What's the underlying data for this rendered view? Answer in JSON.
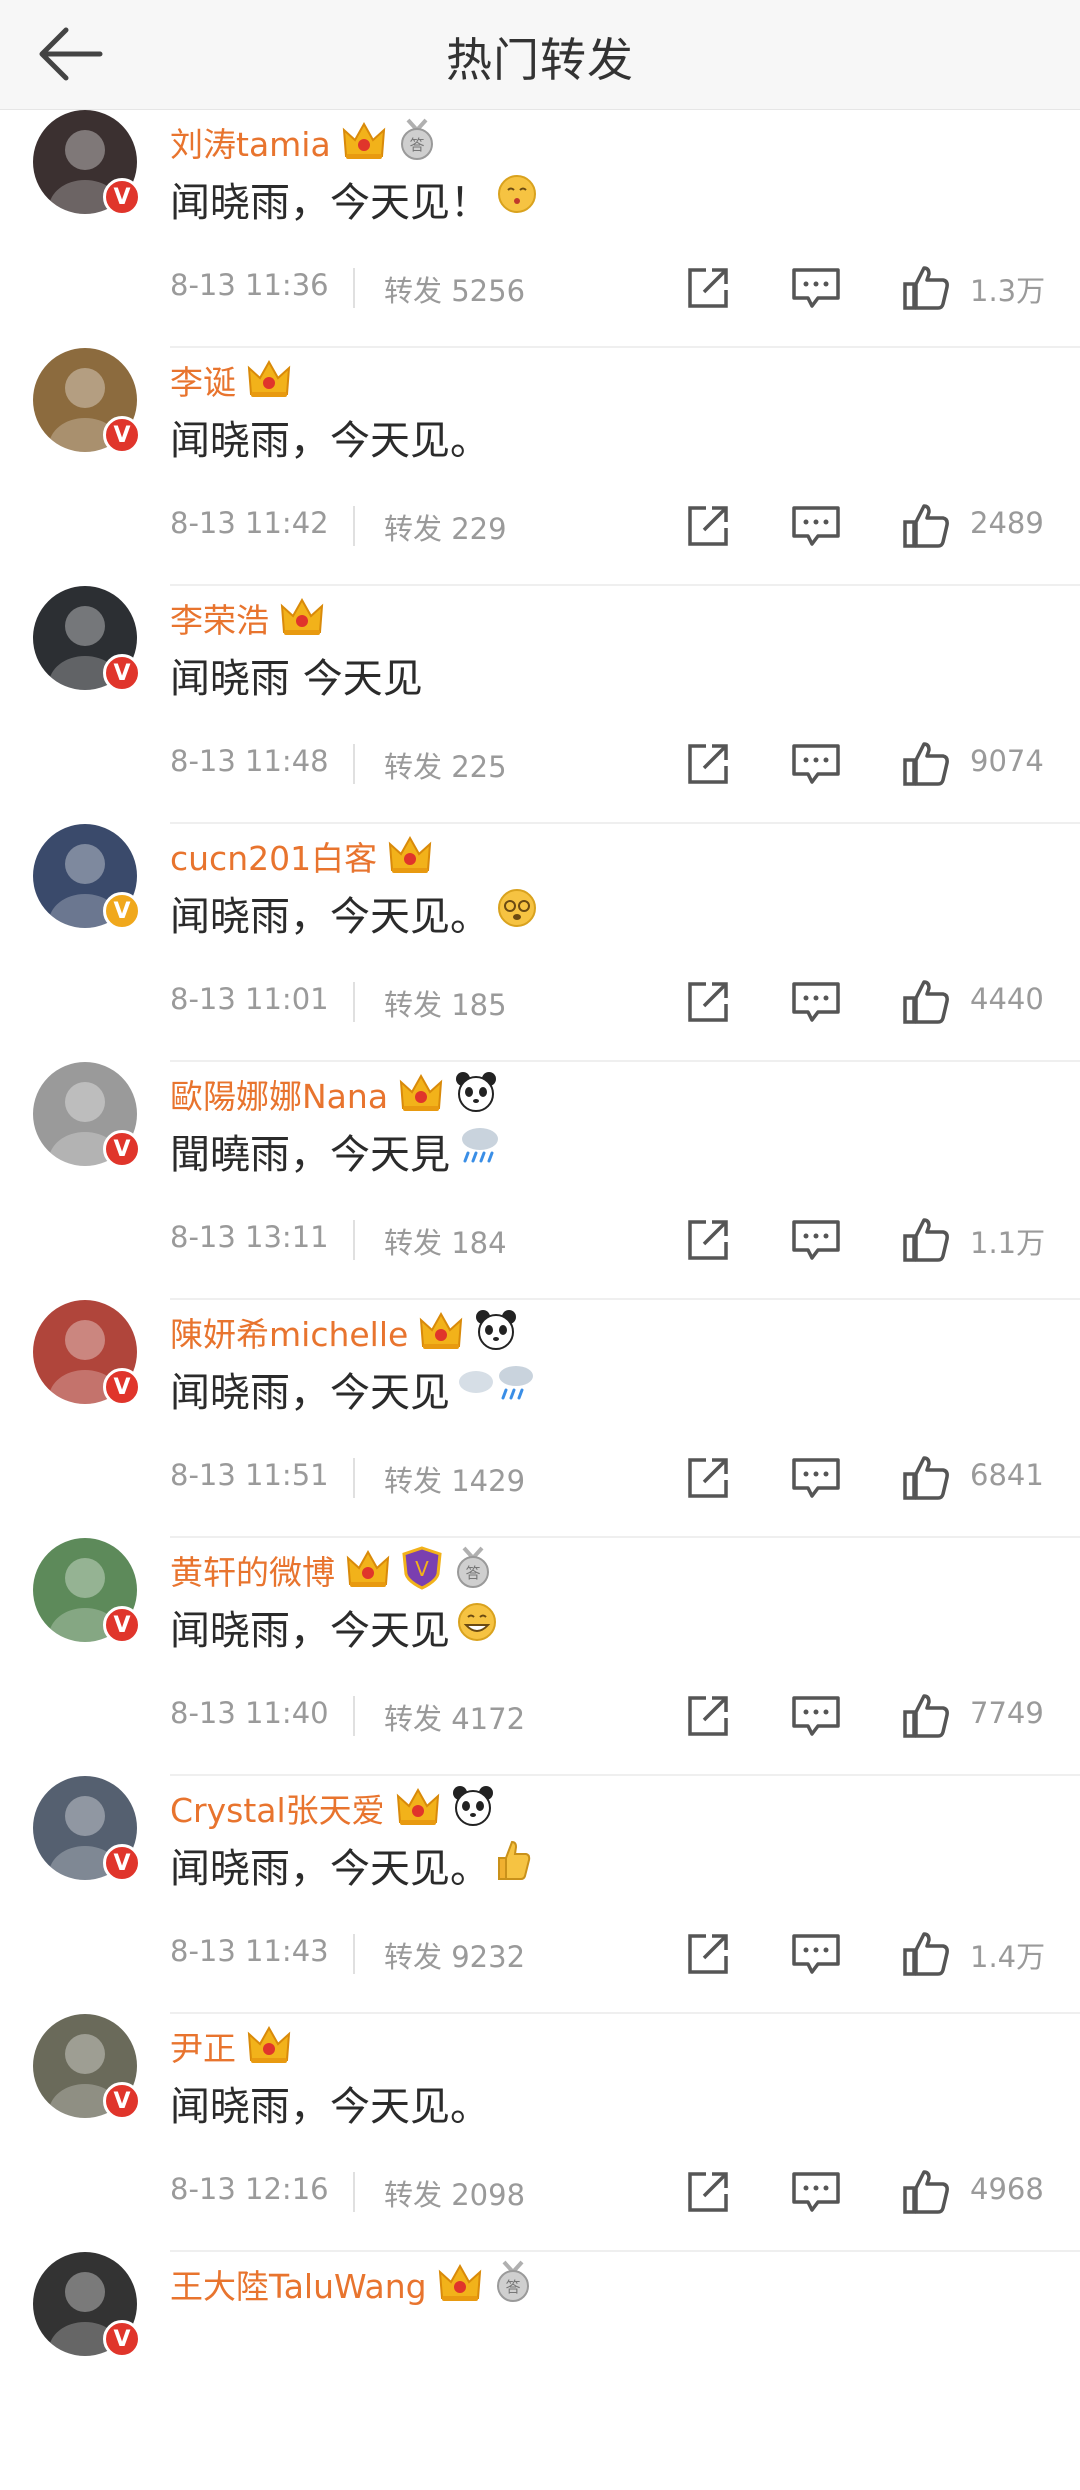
{
  "header": {
    "title": "热门转发"
  },
  "colors": {
    "accent_name": "#e8742e",
    "verified_red": "#e0352b",
    "verified_gold": "#f0a81c",
    "meta_gray": "#9a9a9a"
  },
  "items": [
    {
      "name": "刘涛tamia",
      "text": "闻晓雨，今天见！",
      "time": "8-13 11:36",
      "repost": "转发 5256",
      "likes": "1.3万",
      "badges": [
        "crown-icon",
        "medal-icon"
      ],
      "emoji": "kiss-emoji",
      "avatar_color": "#3b3030",
      "verified": "red"
    },
    {
      "name": "李诞",
      "text": "闻晓雨，今天见。",
      "time": "8-13 11:42",
      "repost": "转发 229",
      "likes": "2489",
      "badges": [
        "crown-icon"
      ],
      "emoji": "",
      "avatar_color": "#8c6b3e",
      "verified": "red"
    },
    {
      "name": "李荣浩",
      "text": "闻晓雨 今天见",
      "time": "8-13 11:48",
      "repost": "转发 225",
      "likes": "9074",
      "badges": [
        "crown-icon"
      ],
      "emoji": "",
      "avatar_color": "#2c2f33",
      "verified": "red"
    },
    {
      "name": "cucn201白客",
      "text": "闻晓雨，今天见。",
      "time": "8-13 11:01",
      "repost": "转发 185",
      "likes": "4440",
      "badges": [
        "crown-icon"
      ],
      "emoji": "dizzy-emoji",
      "avatar_color": "#3a4a6b",
      "verified": "gold"
    },
    {
      "name": "歐陽娜娜Nana",
      "text": "聞曉雨，今天見",
      "time": "8-13 13:11",
      "repost": "转发 184",
      "likes": "1.1万",
      "badges": [
        "crown-icon",
        "panda-icon"
      ],
      "emoji": "rain-emoji",
      "avatar_color": "#9a9a9a",
      "verified": "red"
    },
    {
      "name": "陳妍希michelle",
      "text": "闻晓雨，今天见",
      "time": "8-13 11:51",
      "repost": "转发 1429",
      "likes": "6841",
      "badges": [
        "crown-icon",
        "panda-icon"
      ],
      "emoji": "cloud-rain-emoji",
      "avatar_color": "#b0453b",
      "verified": "red"
    },
    {
      "name": "黄轩的微博",
      "text": "闻晓雨，今天见",
      "time": "8-13 11:40",
      "repost": "转发 4172",
      "likes": "7749",
      "badges": [
        "crown-icon",
        "shield-icon",
        "medal-icon"
      ],
      "emoji": "grin-emoji",
      "avatar_color": "#5d8a5a",
      "verified": "red"
    },
    {
      "name": "Crystal张天爱",
      "text": "闻晓雨，今天见。",
      "time": "8-13 11:43",
      "repost": "转发 9232",
      "likes": "1.4万",
      "badges": [
        "crown-icon",
        "panda-icon"
      ],
      "emoji": "thumb-emoji",
      "avatar_color": "#556070",
      "verified": "red"
    },
    {
      "name": "尹正",
      "text": "闻晓雨，今天见。",
      "time": "8-13 12:16",
      "repost": "转发 2098",
      "likes": "4968",
      "badges": [
        "crown-icon"
      ],
      "emoji": "",
      "avatar_color": "#6a6a5a",
      "verified": "red"
    },
    {
      "name": "王大陸TaluWang",
      "text": "",
      "time": "",
      "repost": "",
      "likes": "",
      "badges": [
        "crown-icon",
        "medal-icon"
      ],
      "emoji": "",
      "avatar_color": "#333333",
      "verified": "red"
    }
  ]
}
